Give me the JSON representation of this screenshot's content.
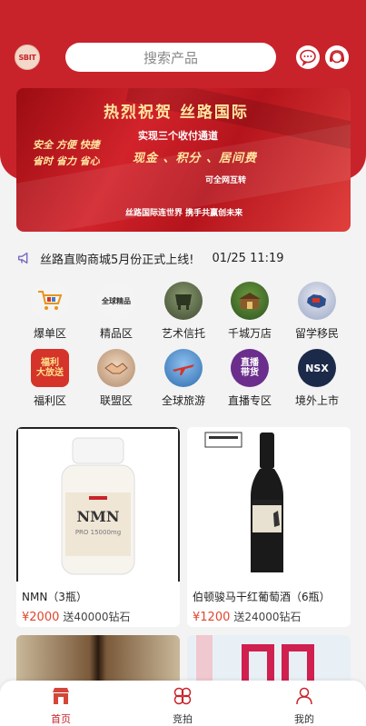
{
  "header": {
    "logo_text": "SBIT",
    "search_placeholder": "搜索产品"
  },
  "banner": {
    "title": "热烈祝贺  丝路国际",
    "subtitle": "实现三个收付通道",
    "slogan": "现金 、积分 、居间费",
    "left_line1": "安全 方便 快捷",
    "left_line2": "省时 省力 省心",
    "interop": "可全网互转",
    "bottom": "丝路国际连世界    携手共赢创未来"
  },
  "notice": {
    "text": "丝路直购商城5月份正式上线!",
    "time": "01/25 11:19"
  },
  "categories": [
    {
      "label": "爆单区",
      "icon": "shopping-cart-icon",
      "color": "#f4f4f4"
    },
    {
      "label": "精品区",
      "icon": "boutique-icon",
      "color": "#f4f4f4"
    },
    {
      "label": "艺术信托",
      "icon": "art-vessel-icon",
      "color": "#5d6a4c"
    },
    {
      "label": "千城万店",
      "icon": "storefront-icon",
      "color": "#3b6b2e"
    },
    {
      "label": "留学移民",
      "icon": "australia-map-icon",
      "color": "#2e4d8c"
    },
    {
      "label": "福利区",
      "icon": "welfare-badge-icon",
      "color": "#d4342a"
    },
    {
      "label": "联盟区",
      "icon": "handshake-icon",
      "color": "#c9a98c"
    },
    {
      "label": "全球旅游",
      "icon": "airplane-icon",
      "color": "#3d7fc4"
    },
    {
      "label": "直播专区",
      "icon": "live-stream-icon",
      "color": "#6b2e8c"
    },
    {
      "label": "境外上市",
      "icon": "nsx-logo-icon",
      "color": "#1c2a4a"
    }
  ],
  "products": [
    {
      "name": "NMN（3瓶）",
      "price": "¥2000",
      "bonus": "送40000钻石",
      "label_top": "NMN",
      "label_sub": "PRO 15000mg"
    },
    {
      "name": "伯顿骏马干红葡萄酒（6瓶）",
      "price": "¥1200",
      "bonus": "送24000钻石",
      "label_top": "",
      "label_sub": ""
    }
  ],
  "tabs": [
    {
      "label": "首页",
      "icon": "shop-home-icon",
      "active": true
    },
    {
      "label": "竞拍",
      "icon": "auction-clover-icon",
      "active": false
    },
    {
      "label": "我的",
      "icon": "user-profile-icon",
      "active": false
    }
  ],
  "colors": {
    "brand": "#c8232b",
    "price": "#e0462d"
  }
}
